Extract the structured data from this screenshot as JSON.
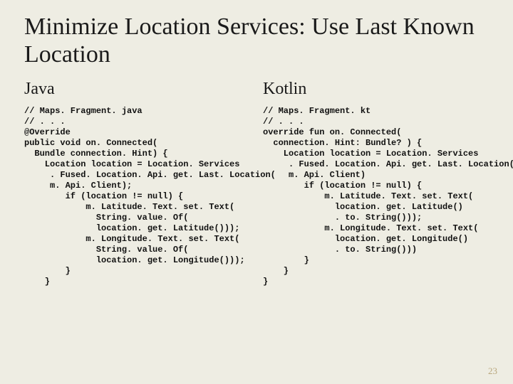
{
  "title": "Minimize Location Services: Use Last Known Location",
  "page_number": "23",
  "left": {
    "heading": "Java",
    "code": "// Maps. Fragment. java\n// . . .\n@Override\npublic void on. Connected(\n  Bundle connection. Hint) {\n    Location location = Location. Services\n     . Fused. Location. Api. get. Last. Location(\n     m. Api. Client);\n        if (location != null) {\n            m. Latitude. Text. set. Text(\n              String. value. Of(\n              location. get. Latitude()));\n            m. Longitude. Text. set. Text(\n              String. value. Of(\n              location. get. Longitude()));\n        }\n    }"
  },
  "right": {
    "heading": "Kotlin",
    "code": "// Maps. Fragment. kt\n// . . .\noverride fun on. Connected(\n  connection. Hint: Bundle? ) {\n    Location location = Location. Services\n     . Fused. Location. Api. get. Last. Location(\n     m. Api. Client)\n        if (location != null) {\n            m. Latitude. Text. set. Text(\n              location. get. Latitude()\n              . to. String()));\n            m. Longitude. Text. set. Text(\n              location. get. Longitude()\n              . to. String()))\n        }\n    }\n}"
  }
}
